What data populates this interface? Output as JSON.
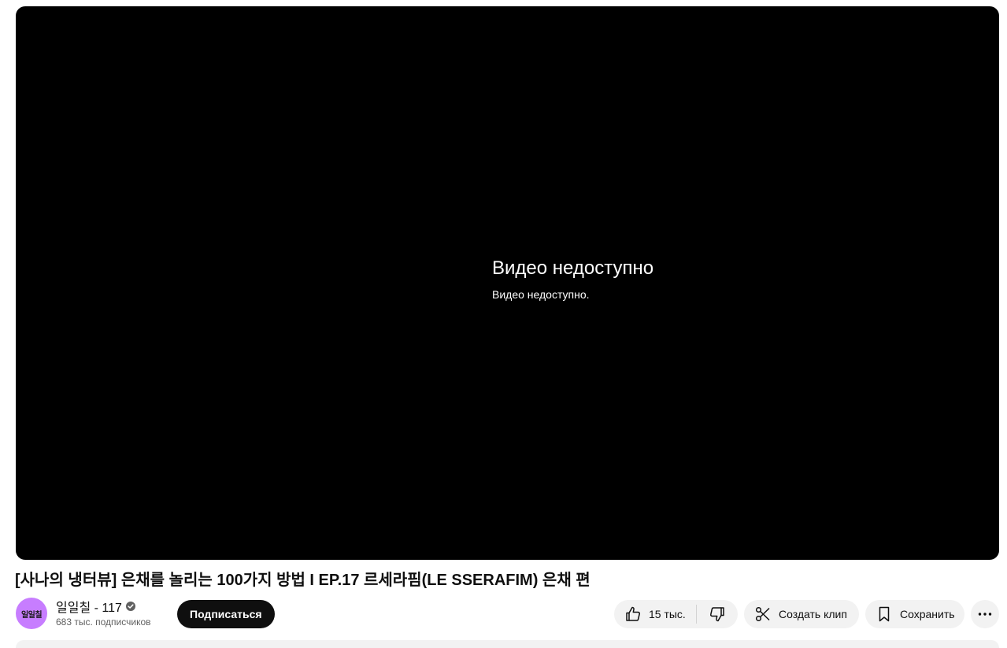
{
  "player": {
    "error_title": "Видео недоступно",
    "error_subtitle": "Видео недоступно."
  },
  "video": {
    "title": "[사나의 냉터뷰] 은채를 놀리는 100가지 방법 I EP.17 르세라핌(LE SSERAFIM) 은채 편"
  },
  "channel": {
    "avatar_text": "일일칠",
    "name": "일일칠 - 117",
    "subscribers": "683 тыс. подписчиков",
    "verified_icon": "verified-check-icon"
  },
  "actions": {
    "subscribe_label": "Подписаться",
    "like_count": "15 тыс.",
    "clip_label": "Создать клип",
    "save_label": "Сохранить"
  },
  "colors": {
    "player_bg": "#000000",
    "avatar_bg": "#c77dff",
    "subscribe_bg": "#0f0f0f",
    "pill_bg": "#f2f2f2"
  }
}
